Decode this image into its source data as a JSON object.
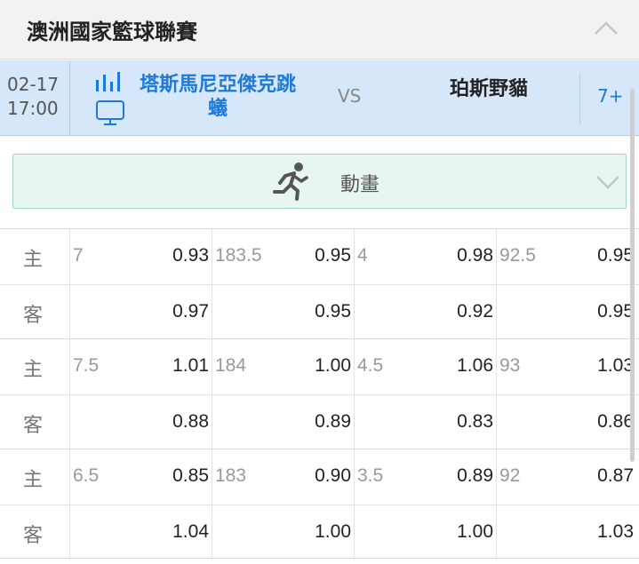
{
  "league": {
    "title": "澳洲國家籃球聯賽"
  },
  "match": {
    "date": "02-17",
    "time": "17:00",
    "home_team": "塔斯馬尼亞傑克跳蟻",
    "vs": "VS",
    "away_team": "珀斯野貓",
    "more_markets": "7+"
  },
  "animation": {
    "label": "動畫"
  },
  "labels": {
    "home": "主",
    "away": "客"
  },
  "odds": [
    {
      "home": {
        "h1": "7",
        "o1": "0.93",
        "h2": "183.5",
        "o2": "0.95",
        "h3": "4",
        "o3": "0.98",
        "h4": "92.5",
        "o4": "0.95"
      },
      "away": {
        "o1": "0.97",
        "o2": "0.95",
        "o3": "0.92",
        "o4": "0.95"
      }
    },
    {
      "home": {
        "h1": "7.5",
        "o1": "1.01",
        "h2": "184",
        "o2": "1.00",
        "h3": "4.5",
        "o3": "1.06",
        "h4": "93",
        "o4": "1.03"
      },
      "away": {
        "o1": "0.88",
        "o2": "0.89",
        "o3": "0.83",
        "o4": "0.86"
      }
    },
    {
      "home": {
        "h1": "6.5",
        "o1": "0.85",
        "h2": "183",
        "o2": "0.90",
        "h3": "3.5",
        "o3": "0.89",
        "h4": "92",
        "o4": "0.87"
      },
      "away": {
        "o1": "1.04",
        "o2": "1.00",
        "o3": "1.00",
        "o4": "1.03"
      }
    }
  ],
  "colors": {
    "accent": "#1e7ad6",
    "match_bg": "#d5e7f8",
    "animation_bg": "#e8f6f0"
  }
}
